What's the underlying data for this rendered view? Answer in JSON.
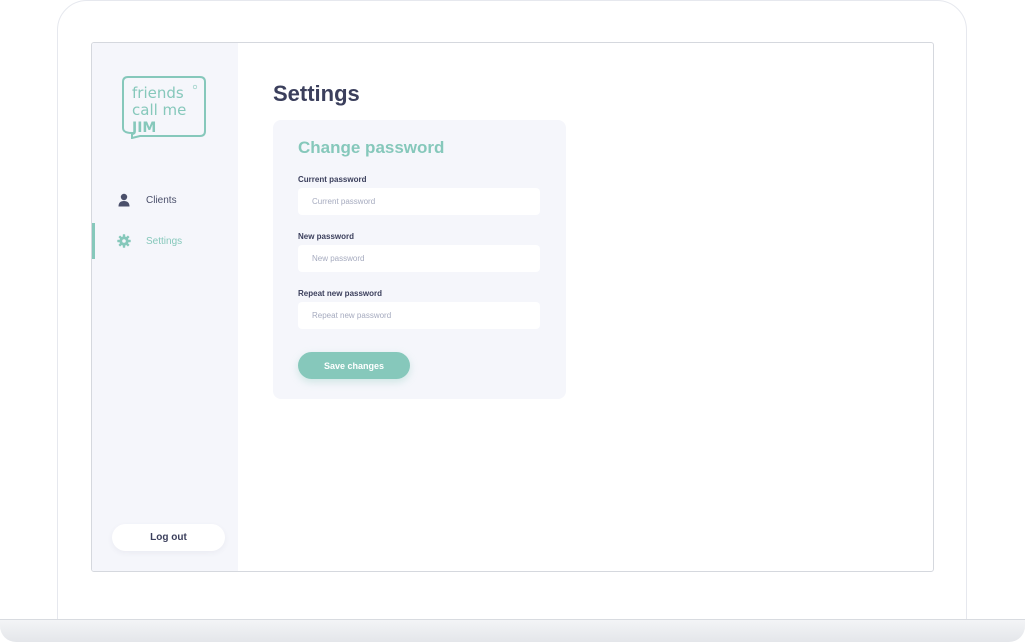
{
  "brand": {
    "logo_line1": "friends",
    "logo_line2": "call me",
    "logo_line3": "JIM",
    "color_accent": "#86c8bb",
    "color_text": "#3b3f5c"
  },
  "sidebar": {
    "items": [
      {
        "label": "Clients",
        "icon": "user-icon",
        "active": false
      },
      {
        "label": "Settings",
        "icon": "gear-icon",
        "active": true
      }
    ],
    "logout_label": "Log out"
  },
  "main": {
    "title": "Settings",
    "card": {
      "title": "Change password",
      "fields": [
        {
          "label": "Current password",
          "placeholder": "Current password"
        },
        {
          "label": "New password",
          "placeholder": "New password"
        },
        {
          "label": "Repeat new password",
          "placeholder": "Repeat new password"
        }
      ],
      "save_label": "Save changes"
    }
  }
}
